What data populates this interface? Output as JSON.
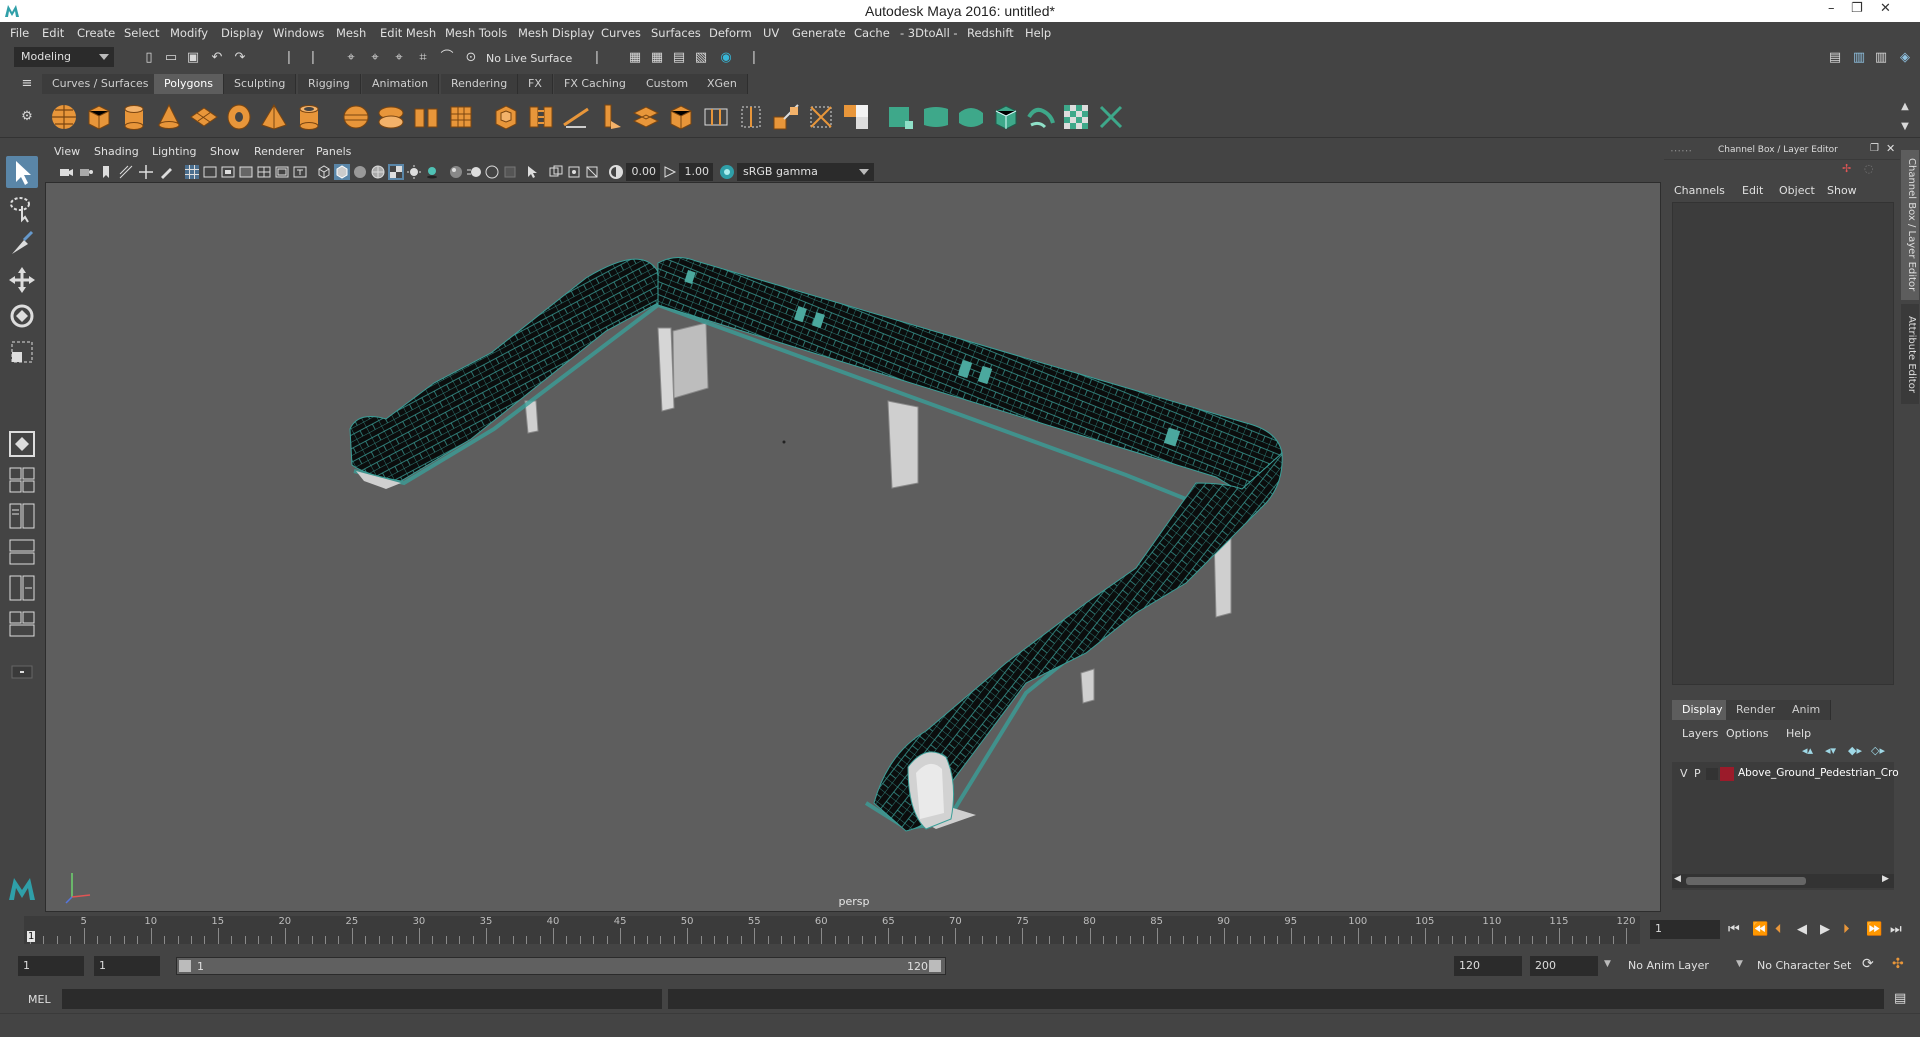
{
  "window": {
    "title": "Autodesk Maya 2016: untitled*",
    "controls": [
      "–",
      "❐",
      "✕"
    ]
  },
  "menubar": [
    "File",
    "Edit",
    "Create",
    "Select",
    "Modify",
    "Display",
    "Windows",
    "Mesh",
    "Edit Mesh",
    "Mesh Tools",
    "Mesh Display",
    "Curves",
    "Surfaces",
    "Deform",
    "UV",
    "Generate",
    "Cache",
    "- 3DtoAll -",
    "Redshift",
    "Help"
  ],
  "statusline": {
    "mode": "Modeling",
    "live_surface": "No Live Surface"
  },
  "shelf": {
    "tabs": [
      "Curves / Surfaces",
      "Polygons",
      "Sculpting",
      "Rigging",
      "Animation",
      "Rendering",
      "FX",
      "FX Caching",
      "Custom",
      "XGen"
    ],
    "active_tab": "Polygons"
  },
  "panel": {
    "menu": [
      "View",
      "Shading",
      "Lighting",
      "Show",
      "Renderer",
      "Panels"
    ],
    "exposure": "0.00",
    "gamma": "1.00",
    "color_space": "sRGB gamma",
    "camera": "persp"
  },
  "channel_box": {
    "header": "Channel Box / Layer Editor",
    "menu": [
      "Channels",
      "Edit",
      "Object",
      "Show"
    ]
  },
  "layer_editor": {
    "tabs": [
      "Display",
      "Render",
      "Anim"
    ],
    "active_tab": "Display",
    "menu": [
      "Layers",
      "Options",
      "Help"
    ],
    "layers": [
      {
        "v": "V",
        "p": "P",
        "color": "#9b1b2a",
        "name": "Above_Ground_Pedestrian_Cro"
      }
    ]
  },
  "side_tabs": [
    "Channel Box / Layer Editor",
    "Attribute Editor"
  ],
  "timeline": {
    "ticks": [
      1,
      5,
      10,
      15,
      20,
      25,
      30,
      35,
      40,
      45,
      50,
      55,
      60,
      65,
      70,
      75,
      80,
      85,
      90,
      95,
      100,
      105,
      110,
      115,
      120
    ],
    "current_frame": "1",
    "current_frame_field": "1"
  },
  "range": {
    "start": "1",
    "playback_start": "1",
    "slider_start": "1",
    "slider_end": "120",
    "playback_end": "120",
    "end": "200",
    "anim_layer": "No Anim Layer",
    "character_set": "No Character Set"
  },
  "command_line": {
    "language": "MEL"
  },
  "colors": {
    "panel_bg": "#444444",
    "viewport_bg": "#5e5e5e",
    "active_highlight": "#5a86a8",
    "shelf_icon": "#e8963a",
    "shelf_icon_green": "#3ea88a",
    "wireframe": "#4fc2b5"
  }
}
